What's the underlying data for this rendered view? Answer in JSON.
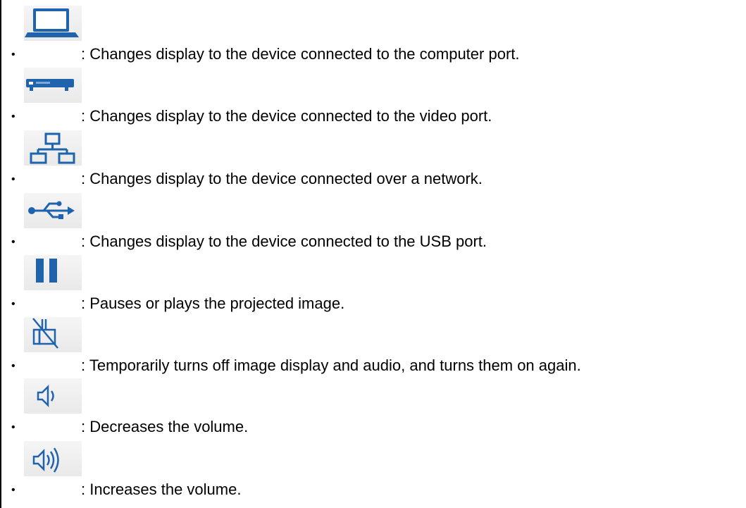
{
  "list": {
    "bullet": "•",
    "items": [
      {
        "icon": "computer-icon",
        "text": ": Changes display to the device connected to the computer port."
      },
      {
        "icon": "video-device-icon",
        "text": ": Changes display to the device connected to the video port."
      },
      {
        "icon": "network-icon",
        "text": ": Changes display to the device connected over a network."
      },
      {
        "icon": "usb-icon",
        "text": ": Changes display to the device connected to the USB port."
      },
      {
        "icon": "pause-icon",
        "text": ": Pauses or plays the projected image."
      },
      {
        "icon": "av-mute-icon",
        "text": ": Temporarily turns off image display and audio, and turns them on again."
      },
      {
        "icon": "volume-down-icon",
        "text": ": Decreases the volume."
      },
      {
        "icon": "volume-up-icon",
        "text": ": Increases the volume."
      }
    ]
  },
  "colors": {
    "icon_blue": "#1f63ad",
    "icon_background": "#ececec",
    "text": "#000000",
    "rule": "#000000"
  }
}
